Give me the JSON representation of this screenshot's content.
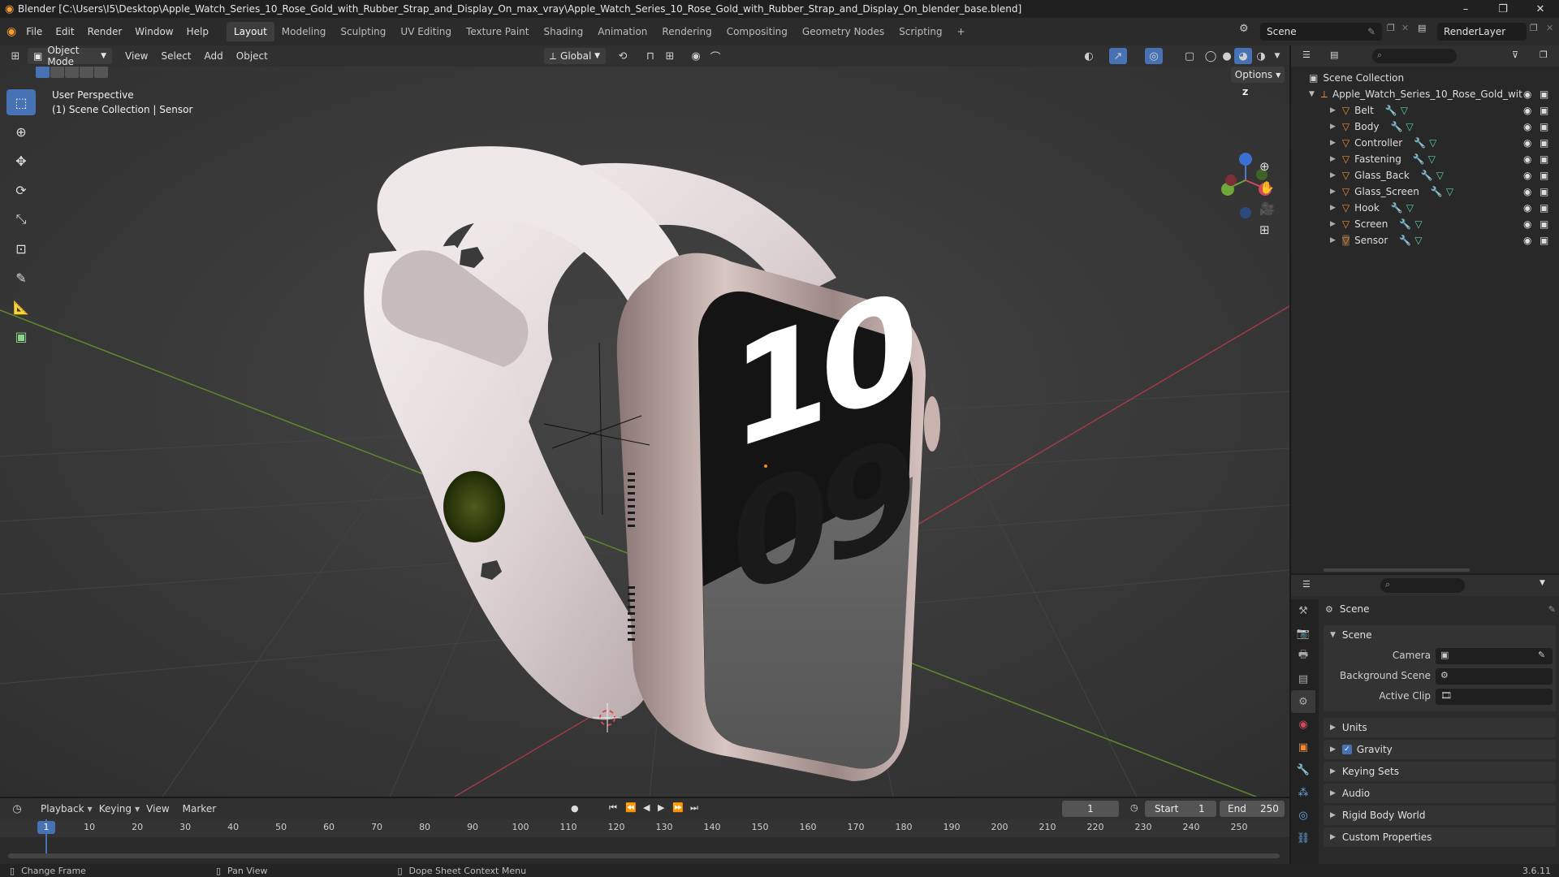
{
  "window": {
    "title": "Blender [C:\\Users\\I5\\Desktop\\Apple_Watch_Series_10_Rose_Gold_with_Rubber_Strap_and_Display_On_max_vray\\Apple_Watch_Series_10_Rose_Gold_with_Rubber_Strap_and_Display_On_blender_base.blend]",
    "controls": [
      "–",
      "❐",
      "✕"
    ]
  },
  "menu": [
    "File",
    "Edit",
    "Render",
    "Window",
    "Help"
  ],
  "workspaces": [
    "Layout",
    "Modeling",
    "Sculpting",
    "UV Editing",
    "Texture Paint",
    "Shading",
    "Animation",
    "Rendering",
    "Compositing",
    "Geometry Nodes",
    "Scripting"
  ],
  "workspace_add": "+",
  "scene_name": "Scene",
  "render_layer": "RenderLayer",
  "viewport_header": {
    "mode": "Object Mode",
    "menus": [
      "View",
      "Select",
      "Add",
      "Object"
    ],
    "transform": "Global",
    "options": "Options"
  },
  "viewport": {
    "perspective": "User Perspective",
    "collection_info": "(1) Scene Collection | Sensor",
    "display_digits_top": "10",
    "display_digits_bottom": "09",
    "gizmo_z": "Z"
  },
  "outliner": {
    "root": "Scene Collection",
    "collection": "Apple_Watch_Series_10_Rose_Gold_wit",
    "objects": [
      "Belt",
      "Body",
      "Controller",
      "Fastening",
      "Glass_Back",
      "Glass_Screen",
      "Hook",
      "Screen",
      "Sensor"
    ],
    "selected": "Sensor"
  },
  "properties": {
    "context_title": "Scene",
    "panel_title": "Scene",
    "fields": [
      {
        "label": "Camera"
      },
      {
        "label": "Background Scene"
      },
      {
        "label": "Active Clip"
      }
    ],
    "sections": [
      "Units",
      "Gravity",
      "Keying Sets",
      "Audio",
      "Rigid Body World",
      "Custom Properties"
    ],
    "gravity_checked": true
  },
  "timeline": {
    "menus": [
      "Playback",
      "Keying",
      "View",
      "Marker"
    ],
    "current_frame": "1",
    "start_label": "Start",
    "start_value": "1",
    "end_label": "End",
    "end_value": "250",
    "ruler": [
      "1",
      "10",
      "20",
      "30",
      "40",
      "50",
      "60",
      "70",
      "80",
      "90",
      "100",
      "110",
      "120",
      "130",
      "140",
      "150",
      "160",
      "170",
      "180",
      "190",
      "200",
      "210",
      "220",
      "230",
      "240",
      "250"
    ]
  },
  "statusbar": {
    "items": [
      "Change Frame",
      "Pan View",
      "Dope Sheet Context Menu"
    ],
    "version": "3.6.11"
  },
  "colors": {
    "accent": "#4772b3",
    "object_icon": "#e98b3a",
    "mesh_icon": "#5fd1a5"
  }
}
